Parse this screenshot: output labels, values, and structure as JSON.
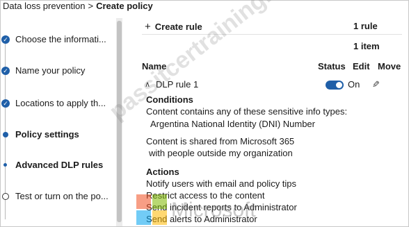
{
  "breadcrumb": {
    "parent": "Data loss prevention",
    "separator": ">",
    "current": "Create policy"
  },
  "steps": [
    {
      "label": "Choose the informati...",
      "state": "done"
    },
    {
      "label": "Name your policy",
      "state": "done"
    },
    {
      "label": "Locations to apply th...",
      "state": "done"
    },
    {
      "label": "Policy settings",
      "state": "current"
    },
    {
      "label": "Advanced DLP rules",
      "state": "current-sub"
    },
    {
      "label": "Test or turn on the po...",
      "state": "pending"
    }
  ],
  "toolbar": {
    "create_rule": "Create rule",
    "rule_count": "1 rule",
    "item_count": "1 item"
  },
  "table": {
    "columns": {
      "name": "Name",
      "status": "Status",
      "edit": "Edit",
      "move": "Move"
    },
    "rules": [
      {
        "name": "DLP rule 1",
        "status": "On"
      }
    ]
  },
  "conditions": {
    "title": "Conditions",
    "line1": "Content contains any of these sensitive info types:",
    "line2": "Argentina National Identity (DNI) Number",
    "line3": "Content is shared from Microsoft 365",
    "line4": "with people outside my organization"
  },
  "actions": {
    "title": "Actions",
    "items": [
      "Notify users with email and policy tips",
      "Restrict access to the content",
      "Send incident reports to Administrator",
      "Send alerts to Administrator"
    ]
  },
  "icons": {
    "check": "checkmark-icon",
    "plus": "plus-icon",
    "chevron": "chevron-up-icon",
    "edit": "pencil-icon"
  },
  "colors": {
    "accent": "#1f5fa8",
    "text": "#1b1b1b"
  },
  "watermark": {
    "text": "passitcertraining.com",
    "brand": "Microsoft"
  }
}
